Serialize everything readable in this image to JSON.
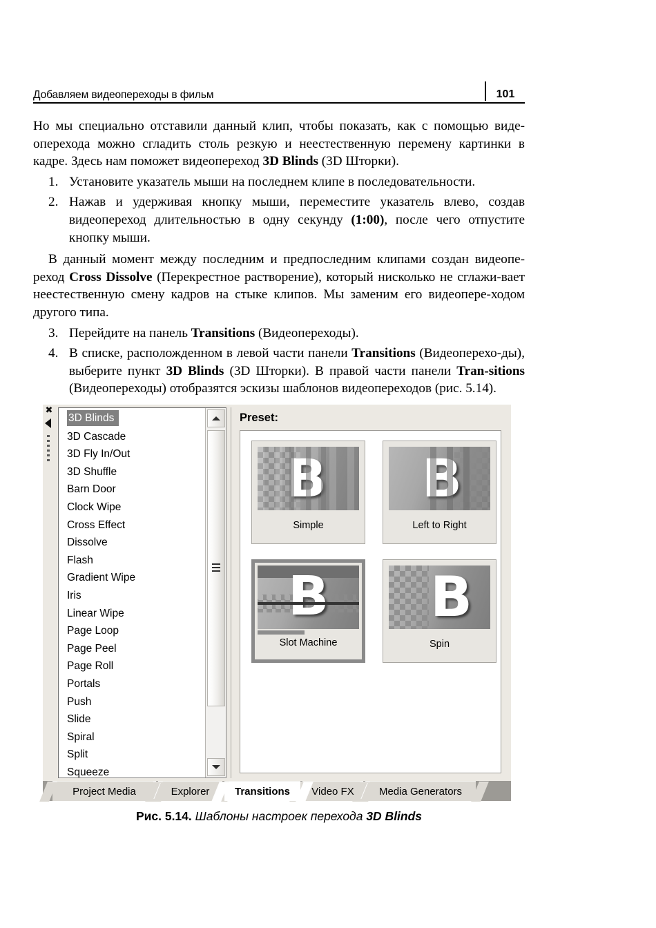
{
  "header": {
    "running_title": "Добавляем видеопереходы в фильм",
    "page_number": "101"
  },
  "body": {
    "para1_a": "Но мы специально отставили данный клип, чтобы показать, как с помощью виде-",
    "para1_b": "оперехода можно сгладить столь резкую и неестественную перемену картинки в",
    "para1_c_pre": "кадре. Здесь нам поможет видеопереход ",
    "para1_c_bold": "3D Blinds",
    "para1_c_post": " (3D Шторки).",
    "step1_num": "1.",
    "step1_text": "Установите указатель мыши на последнем клипе в последовательности.",
    "step2_num": "2.",
    "step2_a": "Нажав и удерживая кнопку мыши, переместите указатель влево, создав видеопереход длительностью в одну секунду ",
    "step2_bold": "(1:00)",
    "step2_b": ", после чего отпустите кнопку мыши.",
    "para2_a": "В данный момент между последним и предпоследним клипами создан видеопе-реход ",
    "para2_bold": "Cross Dissolve",
    "para2_b": " (Перекрестное растворение), который нисколько не сглажи-вает неестественную смену кадров на стыке клипов. Мы заменим его видеопере-ходом другого типа.",
    "step3_num": "3.",
    "step3_a": "Перейдите на панель ",
    "step3_bold": "Transitions",
    "step3_b": " (Видеопереходы).",
    "step4_num": "4.",
    "step4_a": "В списке, расположденном в левой части панели ",
    "step4_bold1": "Transitions",
    "step4_b": " (Видеоперехо-ды), выберите пункт ",
    "step4_bold2": "3D Blinds",
    "step4_c": " (3D Шторки). В правой части панели ",
    "step4_bold3": "Tran-sitions",
    "step4_d": " (Видеопереходы) отобразятся эскизы шаблонов видеопереходов (рис. 5.14)."
  },
  "figure": {
    "dock": {
      "close_icon": "close-icon",
      "collapse_icon": "collapse-left-icon",
      "grip_icon": "drag-grip-icon"
    },
    "transition_list": {
      "selected": "3D Blinds",
      "items": [
        "3D Blinds",
        "3D Cascade",
        "3D Fly In/Out",
        "3D Shuffle",
        "Barn Door",
        "Clock Wipe",
        "Cross Effect",
        "Dissolve",
        "Flash",
        "Gradient Wipe",
        "Iris",
        "Linear Wipe",
        "Page Loop",
        "Page Peel",
        "Page Roll",
        "Portals",
        "Push",
        "Slide",
        "Spiral",
        "Split",
        "Squeeze"
      ]
    },
    "scrollbar": {
      "up_icon": "scroll-up-arrow-icon",
      "down_icon": "scroll-down-arrow-icon",
      "thumb_grip_icon": "scroll-thumb-grip-icon"
    },
    "preset": {
      "label": "Preset:",
      "selected": "Slot Machine",
      "thumbnails": [
        {
          "label": "Simple",
          "letter": "B",
          "selected": false
        },
        {
          "label": "Left to Right",
          "letter": "B",
          "selected": false
        },
        {
          "label": "Slot Machine",
          "letter": "B",
          "selected": true
        },
        {
          "label": "Spin",
          "letter": "B",
          "selected": false
        }
      ]
    },
    "tabs": [
      {
        "label": "Project Media",
        "active": false
      },
      {
        "label": "Explorer",
        "active": false
      },
      {
        "label": "Transitions",
        "active": true
      },
      {
        "label": "Video FX",
        "active": false
      },
      {
        "label": "Media Generators",
        "active": false
      }
    ]
  },
  "caption": {
    "number": "Рис. 5.14.",
    "text": " Шаблоны настроек перехода ",
    "bold_en": "3D Blinds"
  },
  "colors": {
    "panel_bg": "#ece9e3",
    "list_bg": "#ffffff",
    "selection": "#808080",
    "selection_text": "#ffffff",
    "tab_bg": "#dcd9d3",
    "tab_active_bg": "#ffffff",
    "tabstrip_bg": "#9c9a95",
    "thumb_selected_border": "#8a8a8a"
  }
}
